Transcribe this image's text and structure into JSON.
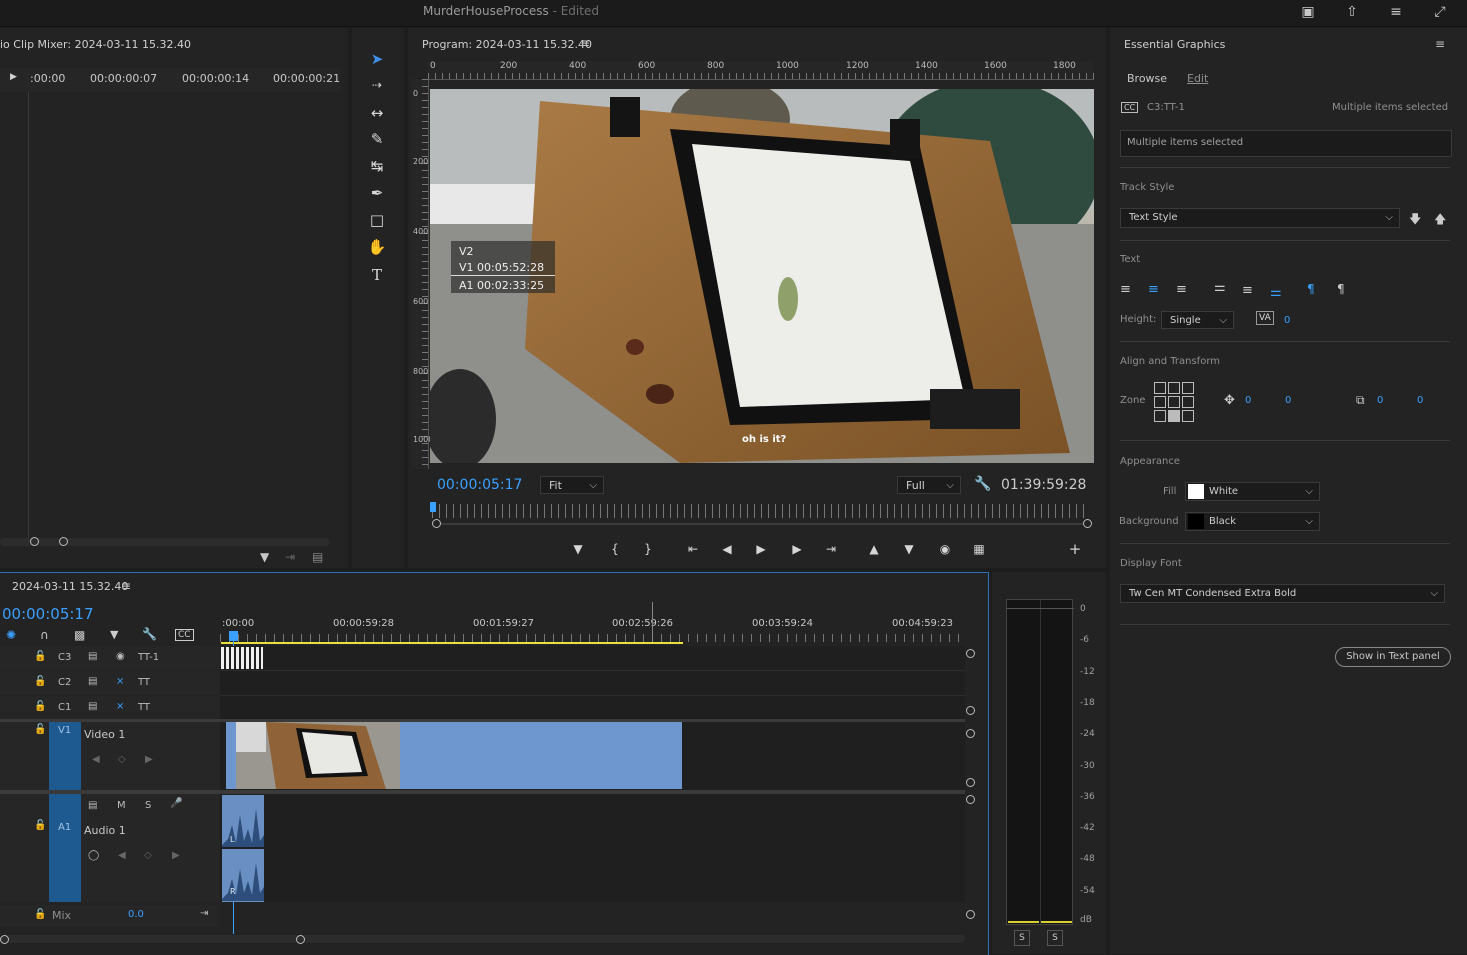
{
  "app": {
    "title": "MurderHouseProcess",
    "title_suffix": "- Edited"
  },
  "source_panel": {
    "title": "io Clip Mixer: 2024-03-11 15.32.40",
    "ruler_labels": [
      ":00:00",
      "00:00:00:07",
      "00:00:00:14",
      "00:00:00:21"
    ]
  },
  "tools": [
    "selection-icon",
    "track-select-icon",
    "ripple-edit-icon",
    "razor-icon",
    "slip-icon",
    "pen-icon",
    "rectangle-icon",
    "hand-icon",
    "type-icon"
  ],
  "program": {
    "title": "Program: 2024-03-11 15.32.40",
    "ruler_top": [
      "0",
      "200",
      "400",
      "600",
      "800",
      "1000",
      "1200",
      "1400",
      "1600",
      "1800"
    ],
    "ruler_left": [
      "0",
      "200",
      "400",
      "600",
      "800",
      "1000"
    ],
    "overlay_lines": [
      "V2",
      "V1 00:05:52:28",
      "A1 00:02:33:25"
    ],
    "caption": "oh is it?",
    "timecode": "00:00:05:17",
    "zoom": "Fit",
    "resolution": "Full",
    "duration": "01:39:59:28"
  },
  "timeline": {
    "sequence_name": "2024-03-11 15.32.40",
    "timecode": "00:00:05:17",
    "ruler_labels": [
      ":00:00",
      "00:00:59:28",
      "00:01:59:27",
      "00:02:59:26",
      "00:03:59:24",
      "00:04:59:23"
    ],
    "tracks": [
      {
        "id": "C3",
        "name": "TT-1"
      },
      {
        "id": "C2",
        "name": "TT"
      },
      {
        "id": "C1",
        "name": "TT"
      }
    ],
    "video_track": {
      "id": "V1",
      "name": "Video 1"
    },
    "audio_track": {
      "id": "A1",
      "name": "Audio 1",
      "m": "M",
      "s": "S"
    },
    "mix_label": "Mix",
    "mix_value": "0.0",
    "audio_channels": [
      "L",
      "R"
    ]
  },
  "meter": {
    "labels": [
      "0",
      "-6",
      "-12",
      "-18",
      "-24",
      "-30",
      "-36",
      "-42",
      "-48",
      "-54",
      "dB"
    ],
    "solo": [
      "S",
      "S"
    ]
  },
  "essential_graphics": {
    "title": "Essential Graphics",
    "tabs": [
      "Browse",
      "Edit"
    ],
    "layer_name": "C3:TT-1",
    "layer_status": "Multiple items selected",
    "text_field": "Multiple items selected",
    "track_style_label": "Track Style",
    "track_style_value": "Text Style",
    "text_label": "Text",
    "height_label": "Height:",
    "height_value": "Single",
    "tracking_value": "0",
    "align_label": "Align and Transform",
    "zone_label": "Zone",
    "pos_x": "0",
    "pos_y": "0",
    "size_x": "0",
    "size_y": "0",
    "appearance_label": "Appearance",
    "fill_label": "Fill",
    "fill_value": "White",
    "background_label": "Background",
    "background_value": "Black",
    "display_font_label": "Display Font",
    "display_font_value": "Tw Cen MT Condensed Extra Bold",
    "show_button": "Show in Text panel"
  },
  "colors": {
    "accent": "#3aa0ff",
    "clip": "#6f97cf",
    "track_id": "#1e5a8f",
    "playhead_line": "#e8e040"
  }
}
